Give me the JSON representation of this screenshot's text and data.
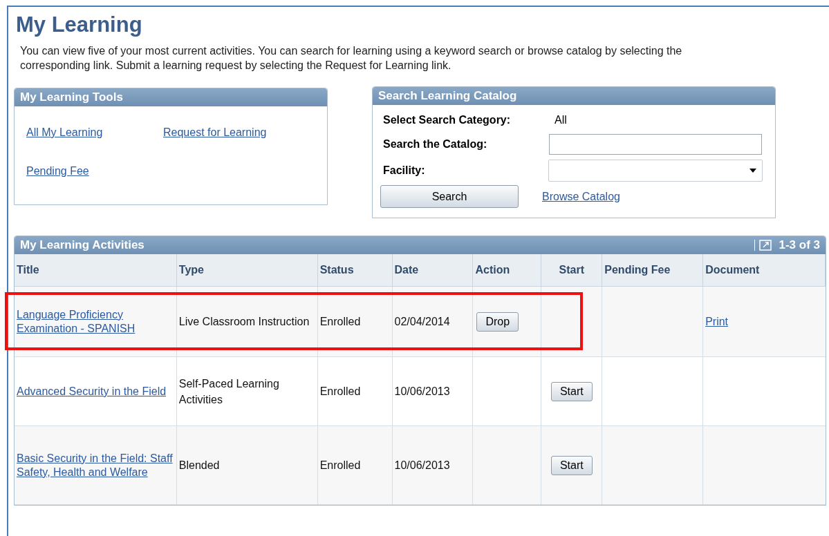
{
  "page": {
    "title": "My Learning",
    "intro": "You can view five of your most current activities. You can search for learning using a keyword search or browse catalog by selecting the corresponding link. Submit a learning request by selecting the Request for Learning link."
  },
  "tools": {
    "title": "My Learning Tools",
    "links": [
      "All My Learning",
      "Request for Learning",
      "Pending Fee"
    ]
  },
  "search": {
    "title": "Search Learning Catalog",
    "category_label": "Select Search Category:",
    "category_value": "All",
    "catalog_label": "Search the Catalog:",
    "facility_label": "Facility:",
    "search_button": "Search",
    "browse_link": "Browse Catalog"
  },
  "activities": {
    "title": "My Learning Activities",
    "range": "1-3 of 3",
    "columns": [
      "Title",
      "Type",
      "Status",
      "Date",
      "Action",
      "Start",
      "Pending Fee",
      "Document"
    ],
    "rows": [
      {
        "title": "Language Proficiency Examination - SPANISH",
        "type": "Live Classroom Instruction",
        "status": "Enrolled",
        "date": "02/04/2014",
        "action": "Drop",
        "document": "Print",
        "highlighted": true
      },
      {
        "title": "Advanced Security in the Field",
        "type": "Self-Paced Learning Activities",
        "status": "Enrolled",
        "date": "10/06/2013",
        "start": "Start",
        "highlighted": false
      },
      {
        "title": "Basic Security in the Field: Staff Safety, Health and Welfare",
        "type": "Blended",
        "status": "Enrolled",
        "date": "10/06/2013",
        "start": "Start",
        "highlighted": false
      }
    ]
  }
}
